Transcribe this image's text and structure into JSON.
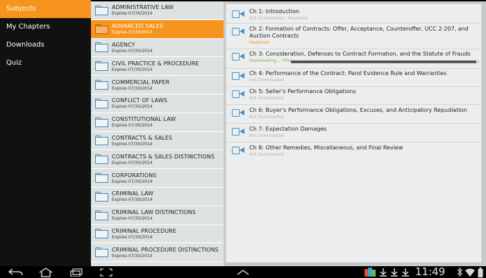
{
  "nav": {
    "items": [
      {
        "label": "Subjects",
        "active": true
      },
      {
        "label": "My Chapters",
        "active": false
      },
      {
        "label": "Downloads",
        "active": false
      },
      {
        "label": "Quiz",
        "active": false
      }
    ]
  },
  "subjects": [
    {
      "name": "ADMINISTRATIVE LAW",
      "expires": "Expires 07/30/2014"
    },
    {
      "name": "ADVANCED SALES",
      "expires": "Expires 07/30/2014",
      "selected": true
    },
    {
      "name": "AGENCY",
      "expires": "Expires 07/30/2014"
    },
    {
      "name": "CIVIL PRACTICE & PROCEDURE",
      "expires": "Expires 07/30/2014"
    },
    {
      "name": "COMMERCIAL PAPER",
      "expires": "Expires 07/30/2014"
    },
    {
      "name": "CONFLICT OF LAWS",
      "expires": "Expires 07/30/2014"
    },
    {
      "name": "CONSTITUTIONAL LAW",
      "expires": "Expires 07/30/2014"
    },
    {
      "name": "CONTRACTS & SALES",
      "expires": "Expires 07/30/2014"
    },
    {
      "name": "CONTRACTS & SALES DISTINCTIONS",
      "expires": "Expires 07/30/2014"
    },
    {
      "name": "CORPORATIONS",
      "expires": "Expires 07/30/2014"
    },
    {
      "name": "CRIMINAL LAW",
      "expires": "Expires 07/30/2014"
    },
    {
      "name": "CRIMINAL LAW DISTINCTIONS",
      "expires": "Expires 07/30/2014"
    },
    {
      "name": "CRIMINAL PROCEDURE",
      "expires": "Expires 07/30/2014"
    },
    {
      "name": "CRIMINAL PROCEDURE DISTINCTIONS",
      "expires": "Expires 07/30/2014"
    }
  ],
  "chapters": [
    {
      "title": "Ch 1: Introduction",
      "status": "Not Downloaded - Mastered",
      "state": "normal"
    },
    {
      "title": "Ch 2: Formation of Contracts: Offer, Acceptance, Counteroffer, UCC 2-207, and",
      "title2": "Auction Contracts",
      "status": "Mastered",
      "state": "mastered"
    },
    {
      "title": "Ch 3: Consideration, Defenses to Contract Formation, and the Statute of Frauds",
      "status": "Downloading... (0%)",
      "state": "downloading",
      "progress": 0.98
    },
    {
      "title": "Ch 4: Performance of the Contract: Parol Evidence Rule and Warranties",
      "status": "Not Downloaded",
      "state": "normal"
    },
    {
      "title": "Ch 5: Seller's Performance Obligations",
      "status": "Not Downloaded",
      "state": "normal"
    },
    {
      "title": "Ch 6: Buyer's Performance Obligations, Excuses, and Anticipatory Repudiation",
      "status": "Not Downloaded",
      "state": "normal"
    },
    {
      "title": "Ch 7: Expectation Damages",
      "status": "Not Downloaded",
      "state": "normal"
    },
    {
      "title": "Ch 8: Other Remedies, Miscellaneous, and Final Review",
      "status": "Not Downloaded",
      "state": "normal"
    }
  ],
  "system": {
    "clock": "11:49",
    "icons": [
      "back-icon",
      "home-icon",
      "recent-apps-icon",
      "screenshot-icon",
      "up-chevron-icon",
      "notification-icon",
      "download-icon",
      "download-icon",
      "bluetooth-icon",
      "wifi-icon",
      "battery-icon"
    ]
  },
  "colors": {
    "accent": "#f7941d",
    "icon_blue": "#3f89b5",
    "downloading": "#7bb542"
  }
}
